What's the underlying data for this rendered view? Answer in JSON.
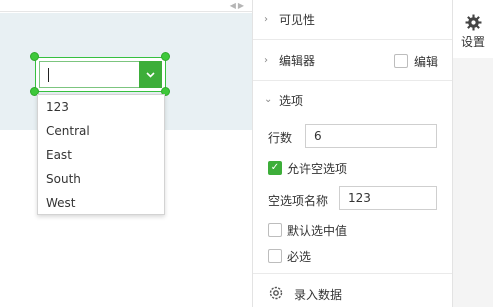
{
  "canvas": {
    "collapse_icon": "double-chevron-icon",
    "combo": {
      "value": "",
      "dropdown_icon": "chevron-down-icon",
      "options": [
        "123",
        "Central",
        "East",
        "South",
        "West"
      ]
    }
  },
  "panel": {
    "visibility": {
      "title": "可见性",
      "collapsed": true
    },
    "editor": {
      "title": "编辑器",
      "collapsed": true,
      "checkbox_label": "编辑",
      "checked": false
    },
    "options": {
      "title": "选项",
      "collapsed": false,
      "rows_label": "行数",
      "rows_value": "6",
      "allow_empty_label": "允许空选项",
      "allow_empty_checked": true,
      "empty_name_label": "空选项名称",
      "empty_name_value": "123",
      "default_middle_label": "默认选中值",
      "default_middle_checked": false,
      "required_label": "必选",
      "required_checked": false
    },
    "record_data": {
      "label": "录入数据",
      "icon": "gear-icon"
    }
  },
  "tabs": {
    "settings_label": "设置",
    "settings_icon": "gear-icon"
  },
  "colors": {
    "accent": "#3dae3a",
    "selection": "#36c03f",
    "canvas_band": "#e8f0f3"
  }
}
